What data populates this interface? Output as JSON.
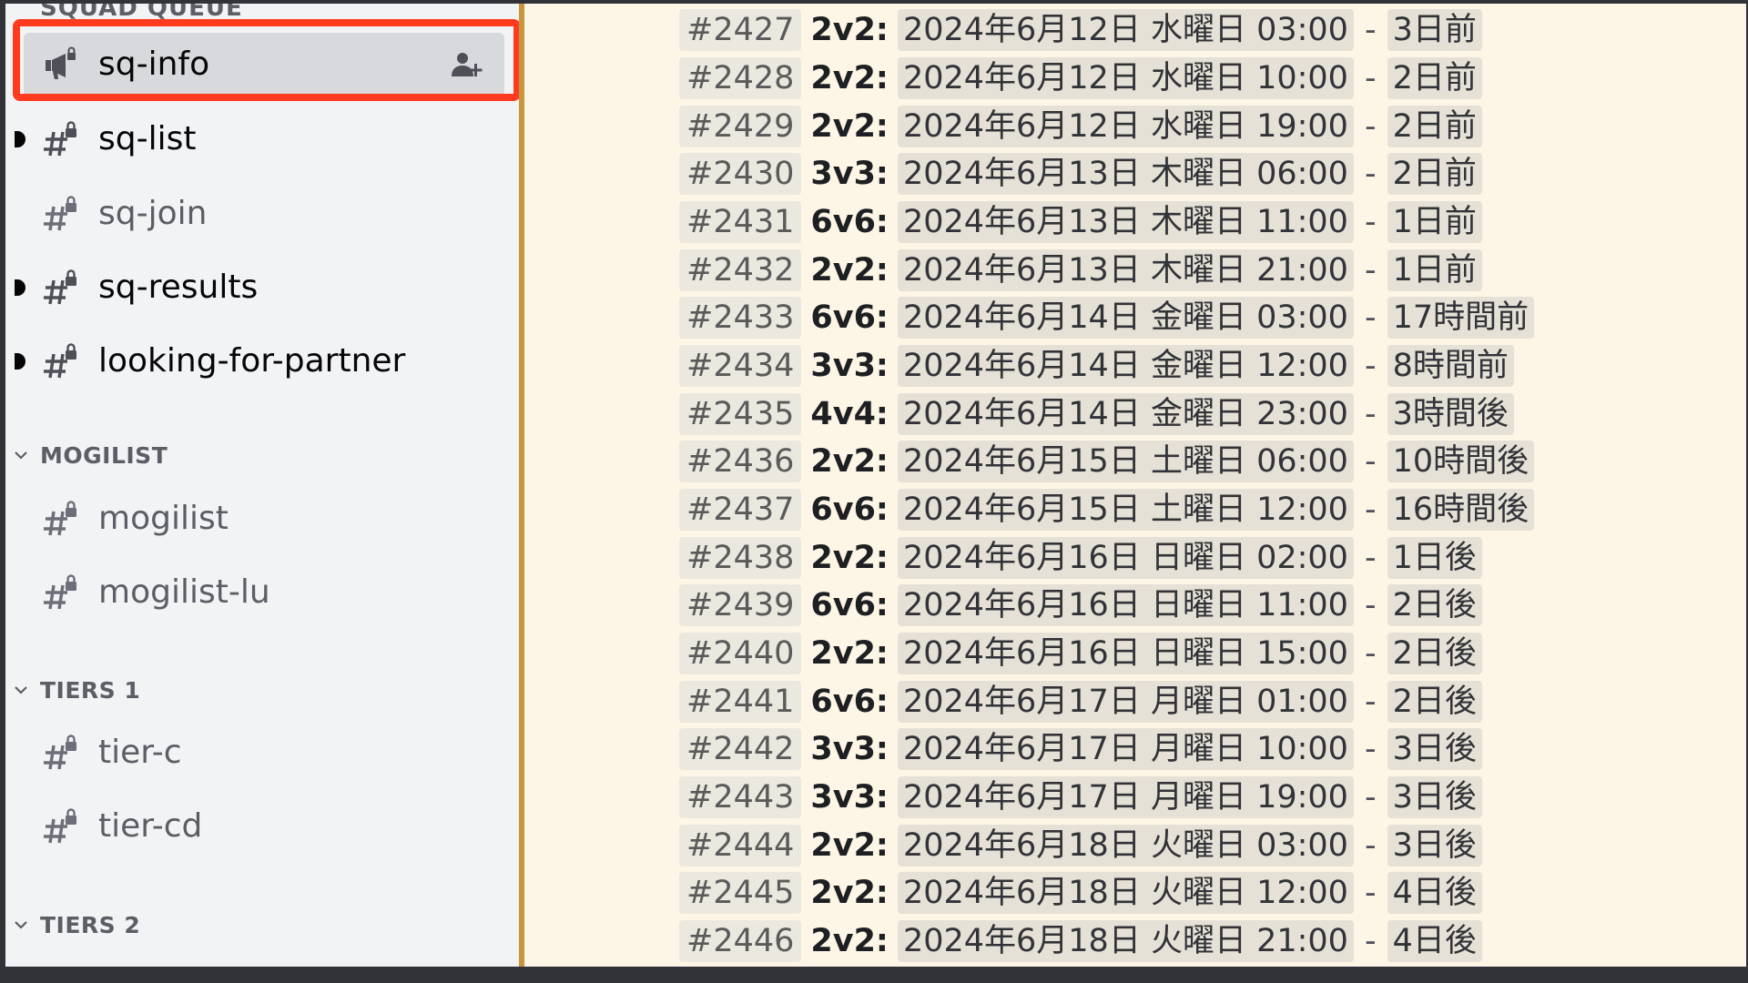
{
  "sidebar": {
    "top_category_cut": "SQUAD QUEUE",
    "channels": [
      {
        "label": "sq-info",
        "icon": "announcement-lock-icon",
        "state": "selected"
      },
      {
        "label": "sq-list",
        "icon": "hash-lock-icon",
        "state": "unread"
      },
      {
        "label": "sq-join",
        "icon": "hash-lock-icon",
        "state": "muted"
      },
      {
        "label": "sq-results",
        "icon": "hash-lock-icon",
        "state": "unread"
      },
      {
        "label": "looking-for-partner",
        "icon": "hash-lock-icon",
        "state": "unread"
      }
    ],
    "categories": [
      {
        "label": "MOGILIST",
        "channels": [
          {
            "label": "mogilist",
            "icon": "hash-lock-icon",
            "state": "muted"
          },
          {
            "label": "mogilist-lu",
            "icon": "hash-lock-icon",
            "state": "muted"
          }
        ]
      },
      {
        "label": "TIERS 1",
        "channels": [
          {
            "label": "tier-c",
            "icon": "hash-lock-icon",
            "state": "muted"
          },
          {
            "label": "tier-cd",
            "icon": "hash-lock-icon",
            "state": "muted"
          }
        ]
      },
      {
        "label": "TIERS 2",
        "channels": []
      }
    ]
  },
  "main": {
    "rows": [
      {
        "num": "#2427",
        "mode": "2v2:",
        "date": "2024年6月12日 水曜日 03:00",
        "rel": "3日前"
      },
      {
        "num": "#2428",
        "mode": "2v2:",
        "date": "2024年6月12日 水曜日 10:00",
        "rel": "2日前"
      },
      {
        "num": "#2429",
        "mode": "2v2:",
        "date": "2024年6月12日 水曜日 19:00",
        "rel": "2日前"
      },
      {
        "num": "#2430",
        "mode": "3v3:",
        "date": "2024年6月13日 木曜日 06:00",
        "rel": "2日前"
      },
      {
        "num": "#2431",
        "mode": "6v6:",
        "date": "2024年6月13日 木曜日 11:00",
        "rel": "1日前"
      },
      {
        "num": "#2432",
        "mode": "2v2:",
        "date": "2024年6月13日 木曜日 21:00",
        "rel": "1日前"
      },
      {
        "num": "#2433",
        "mode": "6v6:",
        "date": "2024年6月14日 金曜日 03:00",
        "rel": "17時間前"
      },
      {
        "num": "#2434",
        "mode": "3v3:",
        "date": "2024年6月14日 金曜日 12:00",
        "rel": "8時間前"
      },
      {
        "num": "#2435",
        "mode": "4v4:",
        "date": "2024年6月14日 金曜日 23:00",
        "rel": "3時間後"
      },
      {
        "num": "#2436",
        "mode": "2v2:",
        "date": "2024年6月15日 土曜日 06:00",
        "rel": "10時間後"
      },
      {
        "num": "#2437",
        "mode": "6v6:",
        "date": "2024年6月15日 土曜日 12:00",
        "rel": "16時間後"
      },
      {
        "num": "#2438",
        "mode": "2v2:",
        "date": "2024年6月16日 日曜日 02:00",
        "rel": "1日後"
      },
      {
        "num": "#2439",
        "mode": "6v6:",
        "date": "2024年6月16日 日曜日 11:00",
        "rel": "2日後"
      },
      {
        "num": "#2440",
        "mode": "2v2:",
        "date": "2024年6月16日 日曜日 15:00",
        "rel": "2日後"
      },
      {
        "num": "#2441",
        "mode": "6v6:",
        "date": "2024年6月17日 月曜日 01:00",
        "rel": "2日後"
      },
      {
        "num": "#2442",
        "mode": "3v3:",
        "date": "2024年6月17日 月曜日 10:00",
        "rel": "3日後"
      },
      {
        "num": "#2443",
        "mode": "3v3:",
        "date": "2024年6月17日 月曜日 19:00",
        "rel": "3日後"
      },
      {
        "num": "#2444",
        "mode": "2v2:",
        "date": "2024年6月18日 火曜日 03:00",
        "rel": "3日後"
      },
      {
        "num": "#2445",
        "mode": "2v2:",
        "date": "2024年6月18日 火曜日 12:00",
        "rel": "4日後"
      },
      {
        "num": "#2446",
        "mode": "2v2:",
        "date": "2024年6月18日 火曜日 21:00",
        "rel": "4日後"
      }
    ]
  },
  "colors": {
    "highlight": "#ff3b1f",
    "sidebar_bg": "#f2f3f5",
    "main_bg": "#fdf6e6",
    "divider": "#c8953f"
  }
}
